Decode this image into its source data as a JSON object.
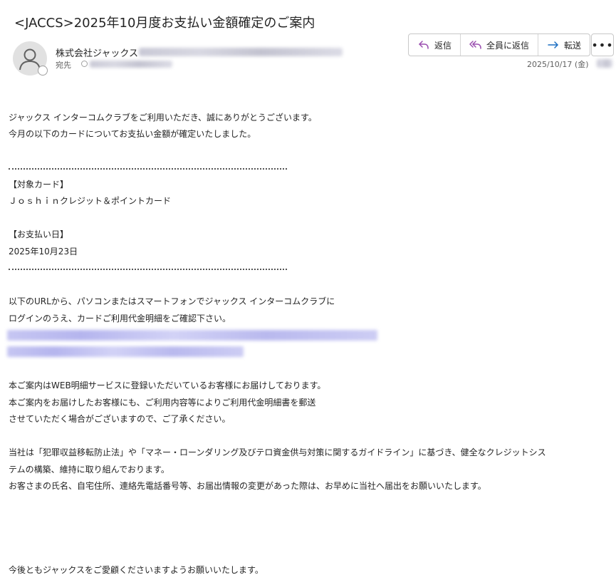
{
  "email": {
    "subject": "<JACCS>2025年10月度お支払い金額確定のご案内",
    "sender_name": "株式会社ジャックス",
    "to_label": "宛先",
    "date": "2025/10/17 (金)"
  },
  "actions": {
    "reply": "返信",
    "reply_all": "全員に返信",
    "forward": "転送",
    "more": "•••"
  },
  "icons": {
    "avatar": "person-icon",
    "reply": "reply-arrow-icon",
    "reply_all": "reply-all-arrow-icon",
    "forward": "forward-arrow-icon",
    "more": "ellipsis-icon"
  },
  "colors": {
    "reply_icon": "#9b4fb0",
    "forward_icon": "#1b6fc2",
    "link_blur": "#b8b8ee"
  },
  "body": {
    "intro_1": "ジャックス インターコムクラブをご利用いただき、誠にありがとうございます。",
    "intro_2": "今月の以下のカードについてお支払い金額が確定いたしました。",
    "card_heading": "【対象カード】",
    "card_name": "Ｊｏｓｈｉｎクレジット＆ポイントカード",
    "pay_heading": "【お支払い日】",
    "pay_date": "2025年10月23日",
    "url_1": "以下のURLから、パソコンまたはスマートフォンでジャックス インターコムクラブに",
    "url_2": "ログインのうえ、カードご利用代金明細をご確認下さい。",
    "notice_1": "本ご案内はWEB明細サービスに登録いただいているお客様にお届けしております。",
    "notice_2": "本ご案内をお届けしたお客様にも、ご利用内容等によりご利用代金明細書を郵送",
    "notice_3": "させていただく場合がございますので、ご了承ください。",
    "law_1": "当社は「犯罪収益移転防止法」や「マネー・ローンダリング及びテロ資金供与対策に関するガイドライン」に基づき、健全なクレジットシス",
    "law_2": "テムの構築、維持に取り組んでおります。",
    "law_3": "お客さまの氏名、自宅住所、連絡先電話番号等、お届出情報の変更があった際は、お早めに当社へ届出をお願いいたします。",
    "closing": "今後ともジャックスをご愛顧くださいますようお願いいたします。"
  }
}
